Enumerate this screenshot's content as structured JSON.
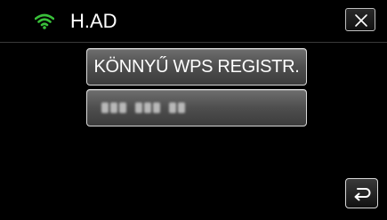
{
  "header": {
    "title": "H.AD",
    "wifi_icon": "wifi-icon",
    "wifi_color": "#39c03a",
    "close_icon": "close-icon"
  },
  "menu": {
    "wps_button_label": "KÖNNYŰ WPS REGISTR.",
    "pin_button_value": "blurred PIN code"
  },
  "footer": {
    "back_icon": "return-icon"
  }
}
